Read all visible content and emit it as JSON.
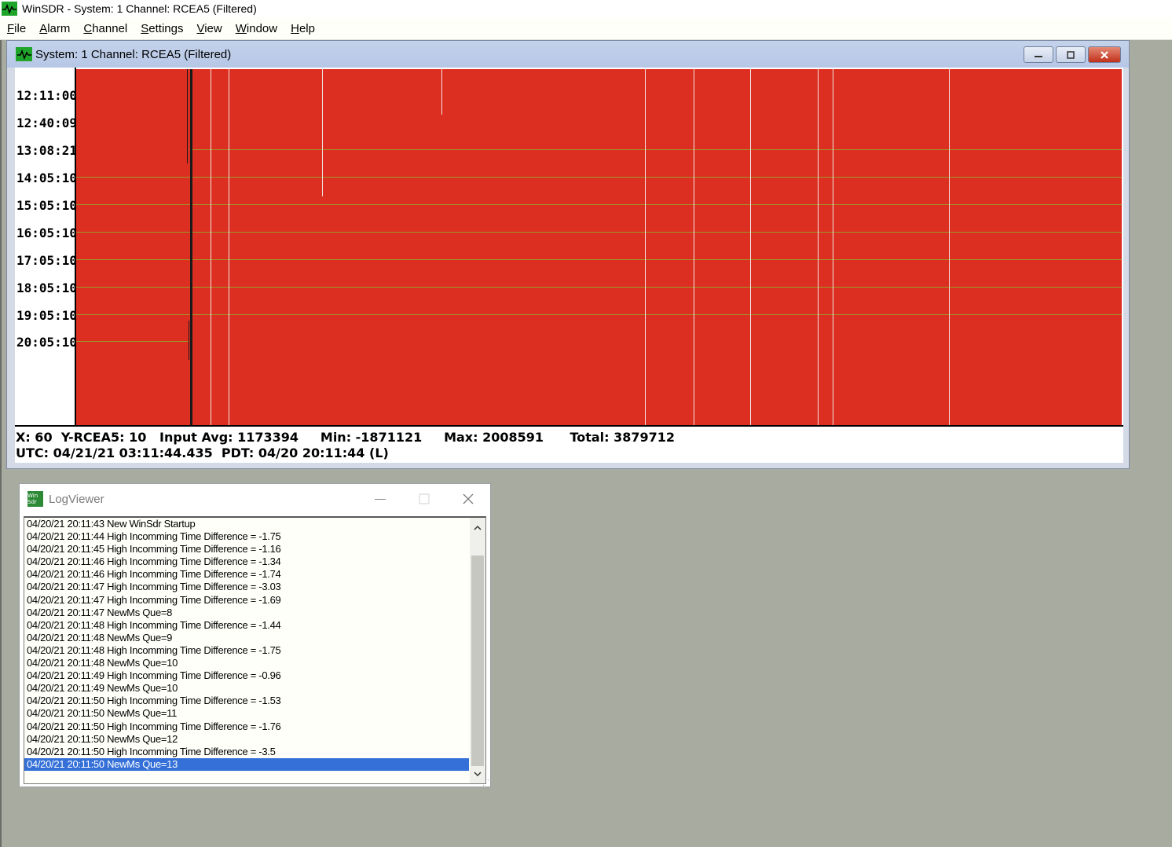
{
  "app": {
    "title": "WinSDR - System: 1 Channel: RCEA5 (Filtered)",
    "menu": [
      "File",
      "Alarm",
      "Channel",
      "Settings",
      "View",
      "Window",
      "Help"
    ],
    "menu_mnemonics": [
      "F",
      "A",
      "C",
      "S",
      "V",
      "W",
      "H"
    ]
  },
  "child_window": {
    "title": "System: 1 Channel: RCEA5 (Filtered)",
    "buttons": [
      "minimize",
      "restore",
      "close"
    ],
    "time_labels": [
      "12:11:00",
      "12:40:09",
      "13:08:21",
      "14:05:10",
      "15:05:10",
      "16:05:10",
      "17:05:10",
      "18:05:10",
      "19:05:10",
      "20:05:10"
    ],
    "plot_color": "#dc2f22",
    "trace_color": "#9b9a2a",
    "status": {
      "line1": "X: 60  Y-RCEA5: 10   Input Avg: 1173394     Min: -1871121     Max: 2008591      Total: 3879712",
      "line2": "UTC: 04/21/21 03:11:44.435  PDT: 04/20 20:11:44 (L)"
    }
  },
  "log_viewer": {
    "title": "LogViewer",
    "icon_text": "Win Sdr",
    "selected_index": 19,
    "lines": [
      "04/20/21 20:11:43 New WinSdr Startup",
      "04/20/21 20:11:44 High Incomming Time Difference = -1.75",
      "04/20/21 20:11:45 High Incomming Time Difference = -1.16",
      "04/20/21 20:11:46 High Incomming Time Difference = -1.34",
      "04/20/21 20:11:46 High Incomming Time Difference = -1.74",
      "04/20/21 20:11:47 High Incomming Time Difference = -3.03",
      "04/20/21 20:11:47 High Incomming Time Difference = -1.69",
      "04/20/21 20:11:47 NewMs Que=8",
      "04/20/21 20:11:48 High Incomming Time Difference = -1.44",
      "04/20/21 20:11:48 NewMs Que=9",
      "04/20/21 20:11:48 High Incomming Time Difference = -1.75",
      "04/20/21 20:11:48 NewMs Que=10",
      "04/20/21 20:11:49 High Incomming Time Difference = -0.96",
      "04/20/21 20:11:49 NewMs Que=10",
      "04/20/21 20:11:50 High Incomming Time Difference = -1.53",
      "04/20/21 20:11:50 NewMs Que=11",
      "04/20/21 20:11:50 High Incomming Time Difference = -1.76",
      "04/20/21 20:11:50 NewMs Que=12",
      "04/20/21 20:11:50 High Incomming Time Difference = -3.5",
      "04/20/21 20:11:50 NewMs Que=13"
    ]
  }
}
